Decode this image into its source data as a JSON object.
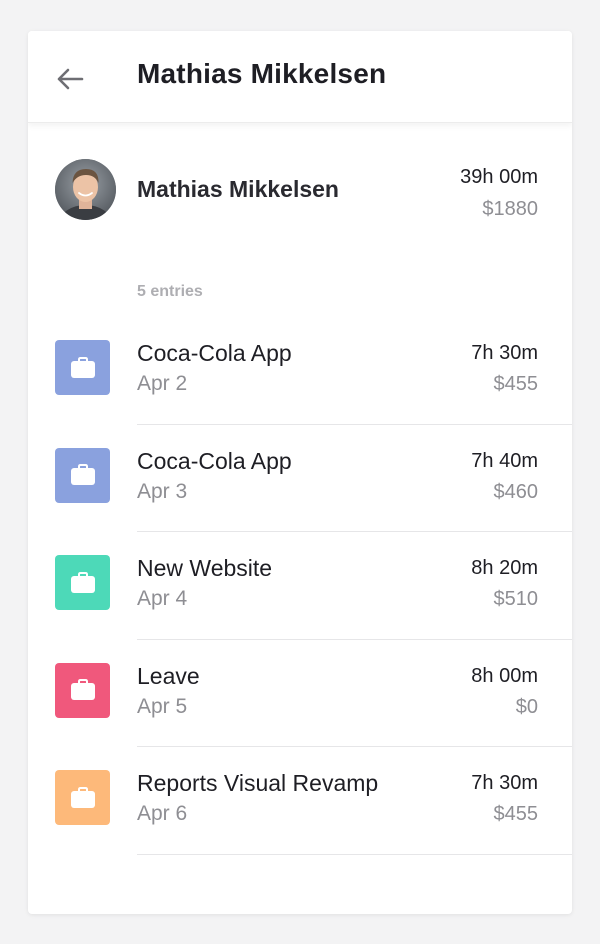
{
  "header": {
    "title": "Mathias Mikkelsen",
    "back_icon": "arrow-left-icon"
  },
  "summary": {
    "avatar_icon": "user-photo-avatar",
    "name": "Mathias Mikkelsen",
    "hours": "39h 00m",
    "amount": "$1880"
  },
  "entries_label": "5 entries",
  "entries": [
    {
      "title": "Coca-Cola App",
      "date": "Apr 2",
      "hours": "7h 30m",
      "amount": "$455",
      "color": "#8aa1de",
      "icon": "briefcase-icon"
    },
    {
      "title": "Coca-Cola App",
      "date": "Apr 3",
      "hours": "7h 40m",
      "amount": "$460",
      "color": "#8aa1de",
      "icon": "briefcase-icon"
    },
    {
      "title": "New Website",
      "date": "Apr 4",
      "hours": "8h 20m",
      "amount": "$510",
      "color": "#4dd9b8",
      "icon": "briefcase-icon"
    },
    {
      "title": "Leave",
      "date": "Apr 5",
      "hours": "8h 00m",
      "amount": "$0",
      "color": "#f0587c",
      "icon": "briefcase-icon"
    },
    {
      "title": "Reports Visual Revamp",
      "date": "Apr 6",
      "hours": "7h 30m",
      "amount": "$455",
      "color": "#fdb97a",
      "icon": "briefcase-icon"
    }
  ]
}
